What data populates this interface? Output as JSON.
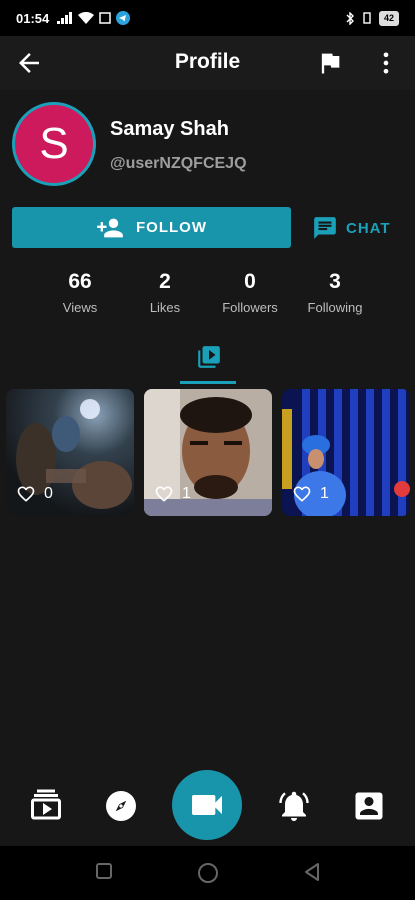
{
  "status_bar": {
    "time": "01:54",
    "battery": "42"
  },
  "app_bar": {
    "title": "Profile",
    "back_icon": "arrow-back-icon",
    "flag_icon": "flag-icon",
    "more_icon": "more-vert-icon"
  },
  "profile": {
    "avatar_letter": "S",
    "avatar_color": "#cc1a5c",
    "name": "Samay Shah",
    "handle": "@userNZQFCEJQ"
  },
  "actions": {
    "follow_label": "FOLLOW",
    "chat_label": "CHAT",
    "accent_color": "#1995ab"
  },
  "stats": [
    {
      "value": "66",
      "label": "Views"
    },
    {
      "value": "2",
      "label": "Likes"
    },
    {
      "value": "0",
      "label": "Followers"
    },
    {
      "value": "3",
      "label": "Following"
    }
  ],
  "tabs": {
    "videos_icon": "video-library-icon"
  },
  "videos": [
    {
      "likes": "0"
    },
    {
      "likes": "1"
    },
    {
      "likes": "1"
    }
  ],
  "bottom_nav": {
    "items": [
      "video-feed-icon",
      "compass-icon",
      "video-camera-icon",
      "bell-icon",
      "profile-icon"
    ]
  }
}
